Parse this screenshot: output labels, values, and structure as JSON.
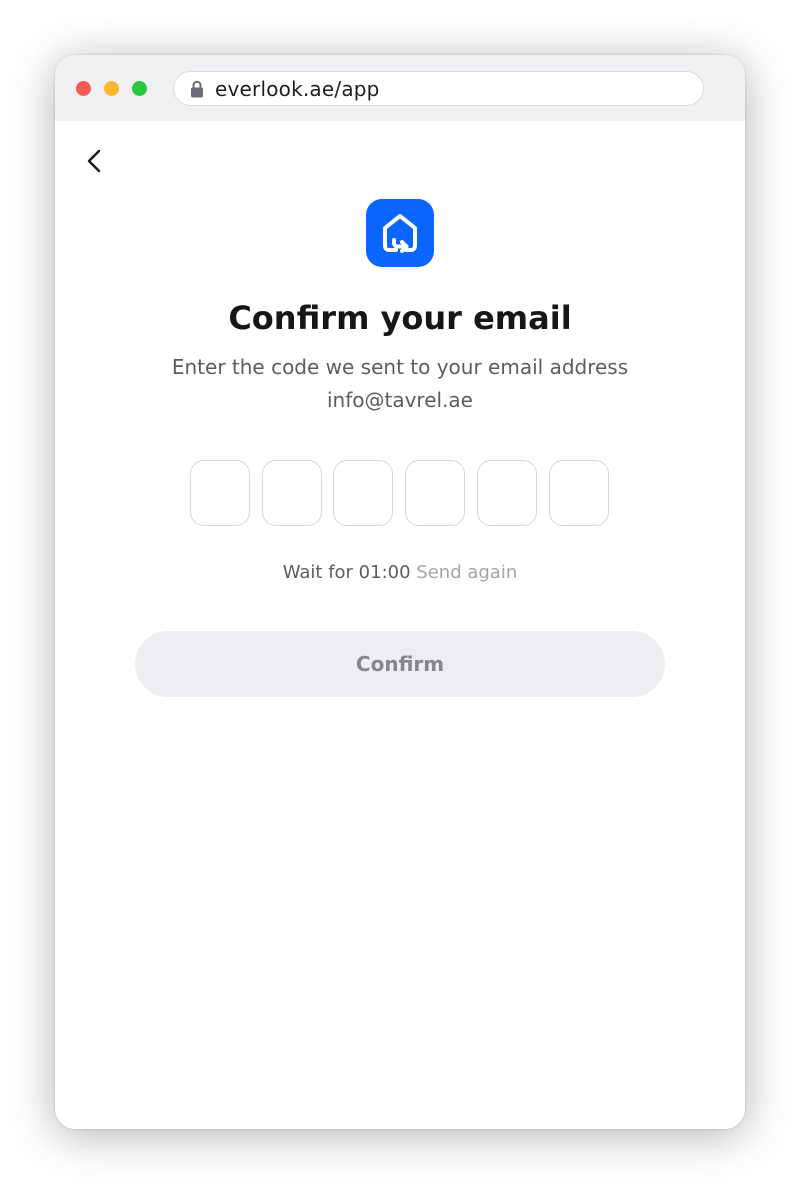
{
  "browser": {
    "url": "everlook.ae/app",
    "lock_icon": "lock-icon"
  },
  "nav": {
    "back_icon": "chevron-left-icon"
  },
  "brand": {
    "logo_icon": "house-arrow-icon",
    "accent_color": "#0a66ff"
  },
  "main": {
    "title": "Confirm your email",
    "subtitle": "Enter the code we sent to your email address",
    "email": "info@tavrel.ae",
    "code_digits": [
      "",
      "",
      "",
      "",
      "",
      ""
    ],
    "timer_prefix": "Wait for 01:00",
    "resend_label": "Send again",
    "confirm_label": "Confirm"
  }
}
